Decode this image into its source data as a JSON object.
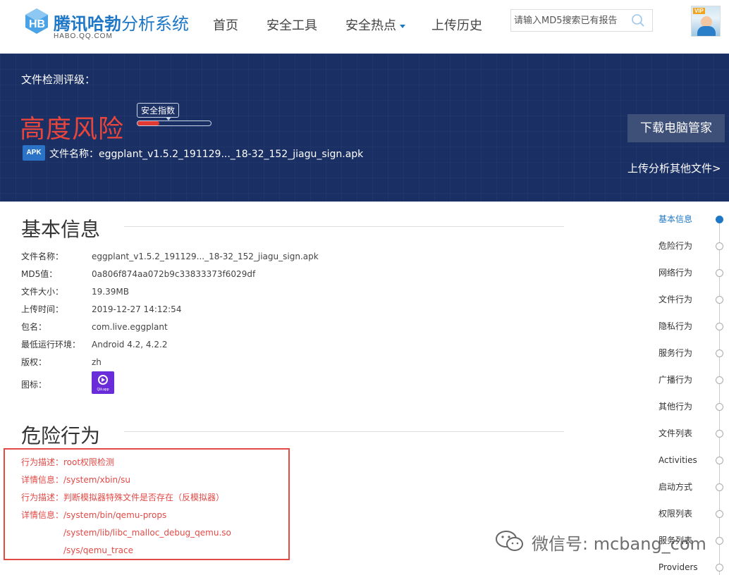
{
  "header": {
    "logo": {
      "title_main": "腾讯哈勃",
      "title_sub": "分析系统",
      "domain": "HABO.QQ.COM"
    },
    "nav": [
      {
        "label": "首页"
      },
      {
        "label": "安全工具"
      },
      {
        "label": "安全热点"
      },
      {
        "label": "上传历史"
      }
    ],
    "search": {
      "placeholder": "请输入MD5搜索已有报告",
      "icon": "search-icon"
    },
    "avatar": {
      "badge": "VIP"
    }
  },
  "banner": {
    "label": "文件检测评级：",
    "risk_level": "高度风险",
    "score_label": "安全指数",
    "score_fraction": 0.3,
    "file_type": "APK",
    "file_name_label": "文件名称：",
    "file_name": "eggplant_v1.5.2_191129..._18-32_152_jiagu_sign.apk",
    "download_button": "下载电脑管家",
    "upload_other": "上传分析其他文件>"
  },
  "basic_info": {
    "title": "基本信息",
    "rows": [
      {
        "label": "文件名称：",
        "value": "eggplant_v1.5.2_191129..._18-32_152_jiagu_sign.apk"
      },
      {
        "label": "MD5值：",
        "value": "0a806f874aa072b9c33833373f6029df"
      },
      {
        "label": "文件大小：",
        "value": "19.39MB"
      },
      {
        "label": "上传时间：",
        "value": "2019-12-27 14:12:54"
      },
      {
        "label": "包名：",
        "value": "com.live.eggplant"
      },
      {
        "label": "最低运行环境：",
        "value": "Android 4.2, 4.2.2"
      },
      {
        "label": "版权：",
        "value": "zh"
      }
    ],
    "icon_label": "图标：",
    "app_icon_text": "Qiii.app"
  },
  "danger": {
    "title": "危险行为",
    "lines": [
      "行为描述：root权限检测",
      "详情信息：/system/xbin/su",
      "行为描述：判断模拟器特殊文件是否存在（反模拟器）",
      "详情信息：/system/bin/qemu-props",
      "/system/lib/libc_malloc_debug_qemu.so",
      "/sys/qemu_trace"
    ]
  },
  "side_nav": [
    {
      "label": "基本信息",
      "active": true
    },
    {
      "label": "危险行为"
    },
    {
      "label": "网络行为"
    },
    {
      "label": "文件行为"
    },
    {
      "label": "隐私行为"
    },
    {
      "label": "服务行为"
    },
    {
      "label": "广播行为"
    },
    {
      "label": "其他行为"
    },
    {
      "label": "文件列表"
    },
    {
      "label": "Activities"
    },
    {
      "label": "启动方式"
    },
    {
      "label": "权限列表"
    },
    {
      "label": "服务列表"
    },
    {
      "label": "Providers"
    }
  ],
  "watermark": {
    "text": "微信号: mcbang_com"
  },
  "colors": {
    "brand": "#1e77c6",
    "banner_bg": "#1a2f63",
    "risk": "#e8453c",
    "danger_border": "#e24a46"
  }
}
